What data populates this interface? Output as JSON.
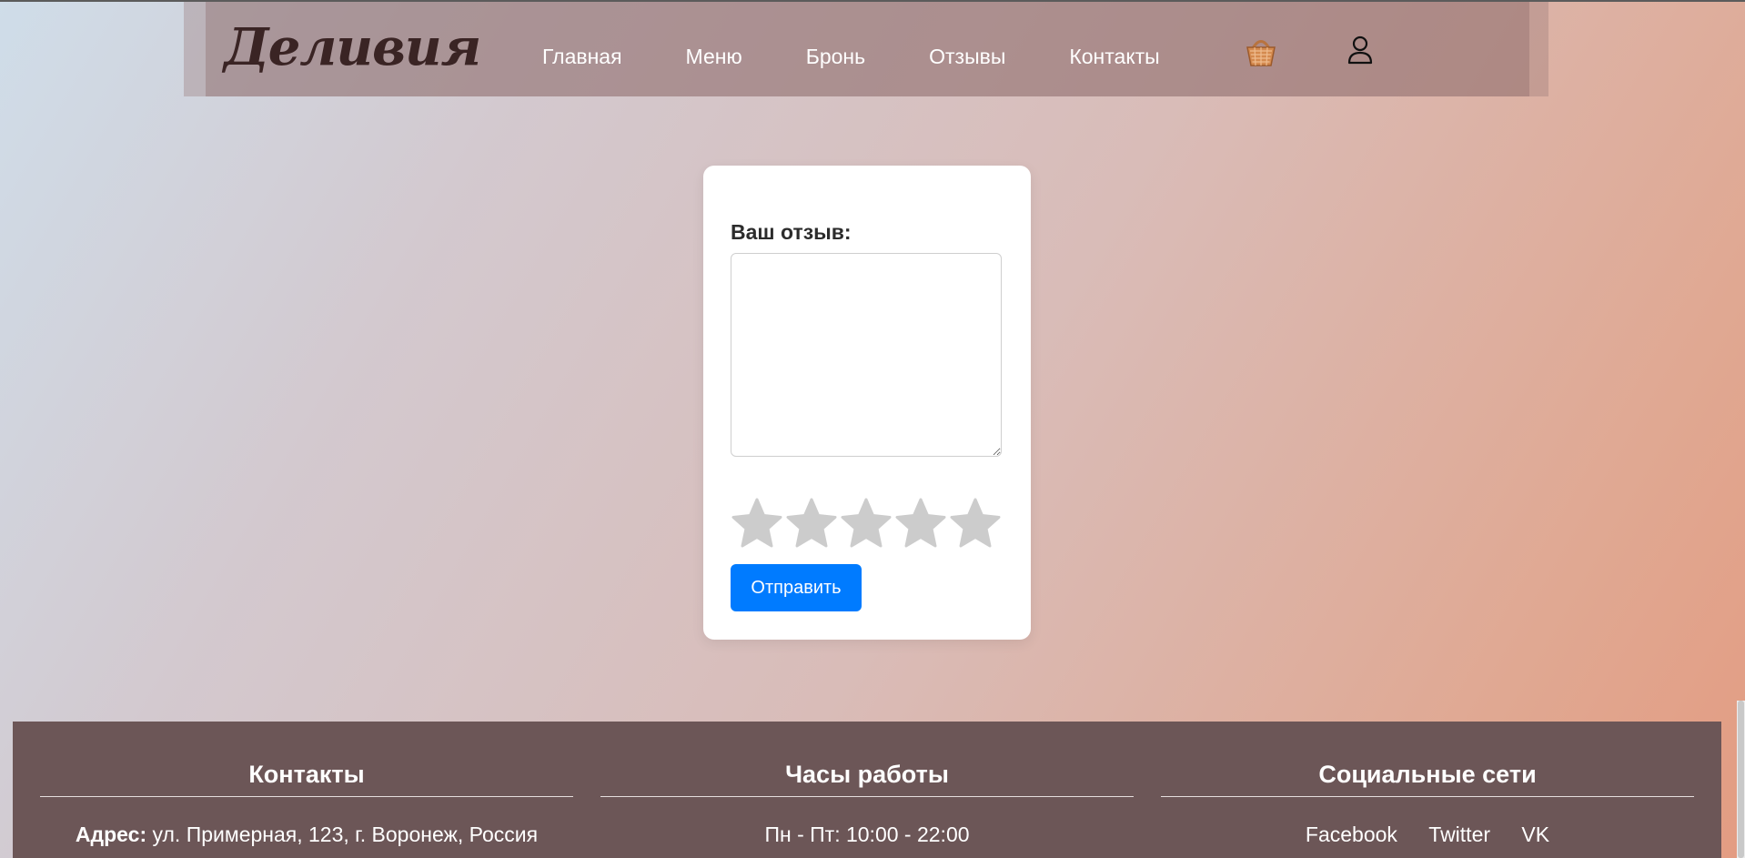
{
  "brand": {
    "logo_text": "Деливия"
  },
  "nav": {
    "items": [
      "Главная",
      "Меню",
      "Бронь",
      "Отзывы",
      "Контакты"
    ]
  },
  "header_icons": {
    "cart": "basket-icon",
    "user": "user-icon"
  },
  "review_form": {
    "label": "Ваш отзыв:",
    "textarea_value": "",
    "rating": 0,
    "max_rating": 5,
    "star_color": "#cccccc",
    "submit_label": "Отправить",
    "submit_color": "#007bff"
  },
  "footer": {
    "contacts": {
      "title": "Контакты",
      "address_label": "Адрес:",
      "address_value": " ул. Примерная, 123, г. Воронеж, Россия"
    },
    "hours": {
      "title": "Часы работы",
      "line1": "Пн - Пт: 10:00 - 22:00"
    },
    "social": {
      "title": "Социальные сети",
      "links": [
        "Facebook",
        "Twitter",
        "VK"
      ]
    },
    "background": "#6c5657"
  }
}
